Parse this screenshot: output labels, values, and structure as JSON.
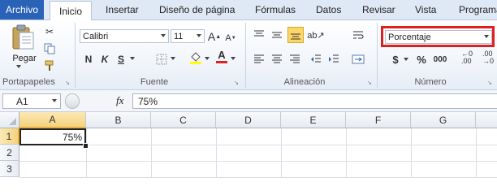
{
  "tabs": {
    "file": "Archivo",
    "home": "Inicio",
    "insert": "Insertar",
    "page_layout": "Diseño de página",
    "formulas": "Fórmulas",
    "data": "Datos",
    "review": "Revisar",
    "view": "Vista",
    "developer": "Programa"
  },
  "groups": {
    "clipboard": "Portapapeles",
    "font": "Fuente",
    "alignment": "Alineación",
    "number": "Número"
  },
  "clipboard": {
    "paste_label": "Pegar"
  },
  "font": {
    "name": "Calibri",
    "size": "11",
    "bold": "N",
    "italic": "K",
    "underline": "S",
    "grow": "A",
    "shrink": "A",
    "color_letter": "A"
  },
  "number": {
    "format": "Porcentaje",
    "currency": "$",
    "percent": "%",
    "comma": "000"
  },
  "formula_bar": {
    "cell_ref": "A1",
    "fx": "fx",
    "value": "75%"
  },
  "columns": [
    "A",
    "B",
    "C",
    "D",
    "E",
    "F",
    "G"
  ],
  "rows": [
    "1",
    "2",
    "3"
  ],
  "cells": {
    "A1": "75%"
  },
  "colors": {
    "file_tab": "#2a62b8",
    "highlight_box": "#e02020",
    "font_color_bar": "#e02020",
    "fill_color_bar": "#ffff00"
  }
}
